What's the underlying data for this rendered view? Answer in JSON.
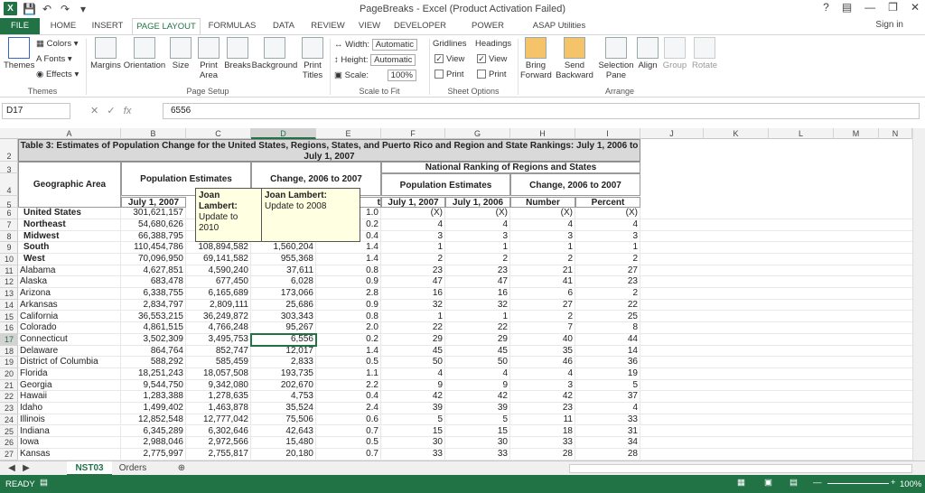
{
  "window": {
    "title": "PageBreaks - Excel (Product Activation Failed)",
    "sign_in": "Sign in",
    "help": "?"
  },
  "tabs": [
    "FILE",
    "HOME",
    "INSERT",
    "PAGE LAYOUT",
    "FORMULAS",
    "DATA",
    "REVIEW",
    "VIEW",
    "DEVELOPER",
    "POWER QUERY",
    "ASAP Utilities"
  ],
  "ribbon": {
    "themes": {
      "themes": "Themes",
      "colors": "Colors",
      "fonts": "Fonts",
      "effects": "Effects",
      "group": "Themes"
    },
    "page_setup": {
      "margins": "Margins",
      "orientation": "Orientation",
      "size": "Size",
      "print_area": "Print Area",
      "breaks": "Breaks",
      "background": "Background",
      "print_titles": "Print Titles",
      "group": "Page Setup"
    },
    "scale": {
      "width_label": "Width:",
      "width_value": "Automatic",
      "height_label": "Height:",
      "height_value": "Automatic",
      "scale_label": "Scale:",
      "scale_value": "100%",
      "group": "Scale to Fit"
    },
    "sheet_options": {
      "gridlines": "Gridlines",
      "headings": "Headings",
      "view": "View",
      "print": "Print",
      "group": "Sheet Options"
    },
    "arrange": {
      "bring_forward": "Bring Forward",
      "send_backward": "Send Backward",
      "selection_pane": "Selection Pane",
      "align": "Align",
      "group_btn": "Group",
      "rotate": "Rotate",
      "group": "Arrange"
    }
  },
  "formula_bar": {
    "name_box": "D17",
    "fx": "fx",
    "value": "6556"
  },
  "columns": [
    "A",
    "B",
    "C",
    "D",
    "E",
    "F",
    "G",
    "H",
    "I",
    "J",
    "K",
    "L",
    "M",
    "N"
  ],
  "table": {
    "title": "Table 3: Estimates of Population Change for the United States, Regions, States, and Puerto Rico and Region and State Rankings: July 1, 2006 to July 1, 2007",
    "h_geo": "Geographic Area",
    "h_popest": "Population Estimates",
    "h_change": "Change, 2006 to 2007",
    "h_national": "National Ranking of Regions and States",
    "h_popest2": "Population Estimates",
    "h_change2": "Change, 2006 to 2007",
    "h_jul2007": "July 1, 2007",
    "h_jul2007b": "July 1, 2007",
    "h_jul2006": "July 1, 2006",
    "h_number": "Number",
    "h_percent": "Percent",
    "h_e_partial": "t",
    "rows": [
      {
        "n": "6",
        "a": "United States",
        "b": "301,621,157",
        "c": "",
        "d": "",
        "e": "1.0",
        "f": "(X)",
        "g": "(X)",
        "h": "(X)",
        "i": "(X)",
        "bold": true
      },
      {
        "n": "7",
        "a": "Northeast",
        "b": "54,680,626",
        "c": "",
        "d": "",
        "e": "0.2",
        "f": "4",
        "g": "4",
        "h": "4",
        "i": "4",
        "bold": true
      },
      {
        "n": "8",
        "a": "Midwest",
        "b": "66,388,795",
        "c": "",
        "d": "",
        "e": "0.4",
        "f": "3",
        "g": "3",
        "h": "3",
        "i": "3",
        "bold": true
      },
      {
        "n": "9",
        "a": "South",
        "b": "110,454,786",
        "c": "108,894,582",
        "d": "1,560,204",
        "e": "1.4",
        "f": "1",
        "g": "1",
        "h": "1",
        "i": "1",
        "bold": true
      },
      {
        "n": "10",
        "a": "West",
        "b": "70,096,950",
        "c": "69,141,582",
        "d": "955,368",
        "e": "1.4",
        "f": "2",
        "g": "2",
        "h": "2",
        "i": "2",
        "bold": true
      },
      {
        "n": "11",
        "a": "Alabama",
        "b": "4,627,851",
        "c": "4,590,240",
        "d": "37,611",
        "e": "0.8",
        "f": "23",
        "g": "23",
        "h": "21",
        "i": "27"
      },
      {
        "n": "12",
        "a": "Alaska",
        "b": "683,478",
        "c": "677,450",
        "d": "6,028",
        "e": "0.9",
        "f": "47",
        "g": "47",
        "h": "41",
        "i": "23"
      },
      {
        "n": "13",
        "a": "Arizona",
        "b": "6,338,755",
        "c": "6,165,689",
        "d": "173,066",
        "e": "2.8",
        "f": "16",
        "g": "16",
        "h": "6",
        "i": "2"
      },
      {
        "n": "14",
        "a": "Arkansas",
        "b": "2,834,797",
        "c": "2,809,111",
        "d": "25,686",
        "e": "0.9",
        "f": "32",
        "g": "32",
        "h": "27",
        "i": "22"
      },
      {
        "n": "15",
        "a": "California",
        "b": "36,553,215",
        "c": "36,249,872",
        "d": "303,343",
        "e": "0.8",
        "f": "1",
        "g": "1",
        "h": "2",
        "i": "25"
      },
      {
        "n": "16",
        "a": "Colorado",
        "b": "4,861,515",
        "c": "4,766,248",
        "d": "95,267",
        "e": "2.0",
        "f": "22",
        "g": "22",
        "h": "7",
        "i": "8"
      },
      {
        "n": "17",
        "a": "Connecticut",
        "b": "3,502,309",
        "c": "3,495,753",
        "d": "6,556",
        "e": "0.2",
        "f": "29",
        "g": "29",
        "h": "40",
        "i": "44"
      },
      {
        "n": "18",
        "a": "Delaware",
        "b": "864,764",
        "c": "852,747",
        "d": "12,017",
        "e": "1.4",
        "f": "45",
        "g": "45",
        "h": "35",
        "i": "14"
      },
      {
        "n": "19",
        "a": "District of Columbia",
        "b": "588,292",
        "c": "585,459",
        "d": "2,833",
        "e": "0.5",
        "f": "50",
        "g": "50",
        "h": "46",
        "i": "36"
      },
      {
        "n": "20",
        "a": "Florida",
        "b": "18,251,243",
        "c": "18,057,508",
        "d": "193,735",
        "e": "1.1",
        "f": "4",
        "g": "4",
        "h": "4",
        "i": "19"
      },
      {
        "n": "21",
        "a": "Georgia",
        "b": "9,544,750",
        "c": "9,342,080",
        "d": "202,670",
        "e": "2.2",
        "f": "9",
        "g": "9",
        "h": "3",
        "i": "5"
      },
      {
        "n": "22",
        "a": "Hawaii",
        "b": "1,283,388",
        "c": "1,278,635",
        "d": "4,753",
        "e": "0.4",
        "f": "42",
        "g": "42",
        "h": "42",
        "i": "37"
      },
      {
        "n": "23",
        "a": "Idaho",
        "b": "1,499,402",
        "c": "1,463,878",
        "d": "35,524",
        "e": "2.4",
        "f": "39",
        "g": "39",
        "h": "23",
        "i": "4"
      },
      {
        "n": "24",
        "a": "Illinois",
        "b": "12,852,548",
        "c": "12,777,042",
        "d": "75,506",
        "e": "0.6",
        "f": "5",
        "g": "5",
        "h": "11",
        "i": "33"
      },
      {
        "n": "25",
        "a": "Indiana",
        "b": "6,345,289",
        "c": "6,302,646",
        "d": "42,643",
        "e": "0.7",
        "f": "15",
        "g": "15",
        "h": "18",
        "i": "31"
      },
      {
        "n": "26",
        "a": "Iowa",
        "b": "2,988,046",
        "c": "2,972,566",
        "d": "15,480",
        "e": "0.5",
        "f": "30",
        "g": "30",
        "h": "33",
        "i": "34"
      },
      {
        "n": "27",
        "a": "Kansas",
        "b": "2,775,997",
        "c": "2,755,817",
        "d": "20,180",
        "e": "0.7",
        "f": "33",
        "g": "33",
        "h": "28",
        "i": "28"
      }
    ]
  },
  "comments": [
    {
      "author": "Joan Lambert:",
      "text": "Update to 2010"
    },
    {
      "author": "Joan Lambert:",
      "text": "Update to 2008"
    }
  ],
  "sheets": [
    "NST03",
    "Orders"
  ],
  "status": {
    "ready": "READY",
    "zoom": "100%"
  }
}
